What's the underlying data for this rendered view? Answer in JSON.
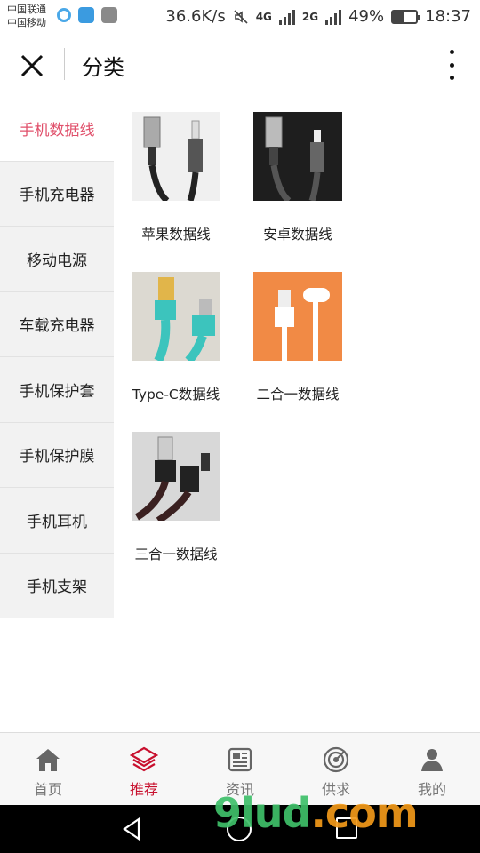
{
  "status_bar": {
    "carrier_1": "中国联通",
    "carrier_2": "中国移动",
    "speed": "36.6K/s",
    "network_1": "4G",
    "network_2": "2G",
    "battery": "49%",
    "battery_level": 0.49,
    "time": "18:37"
  },
  "header": {
    "title": "分类",
    "close_icon": "close-icon",
    "more_icon": "more-vertical-icon"
  },
  "sidebar": {
    "active_index": 0,
    "items": [
      {
        "label": "手机数据线"
      },
      {
        "label": "手机充电器"
      },
      {
        "label": "移动电源"
      },
      {
        "label": "车载充电器"
      },
      {
        "label": "手机保护套"
      },
      {
        "label": "手机保护膜"
      },
      {
        "label": "手机耳机"
      },
      {
        "label": "手机支架"
      }
    ]
  },
  "products": [
    {
      "label": "苹果数据线"
    },
    {
      "label": "安卓数据线"
    },
    {
      "label": "Type-C数据线"
    },
    {
      "label": "二合一数据线"
    },
    {
      "label": "三合一数据线"
    }
  ],
  "tabbar": {
    "active_index": 1,
    "items": [
      {
        "label": "首页",
        "icon": "home-icon"
      },
      {
        "label": "推荐",
        "icon": "layers-icon"
      },
      {
        "label": "资讯",
        "icon": "news-icon"
      },
      {
        "label": "供求",
        "icon": "target-icon"
      },
      {
        "label": "我的",
        "icon": "user-icon"
      }
    ]
  },
  "watermark": {
    "brand": "9lud",
    "suffix": ".com"
  },
  "colors": {
    "accent": "#e0506b",
    "tab_active": "#c8102e",
    "sidebar_bg": "#f2f2f2"
  }
}
